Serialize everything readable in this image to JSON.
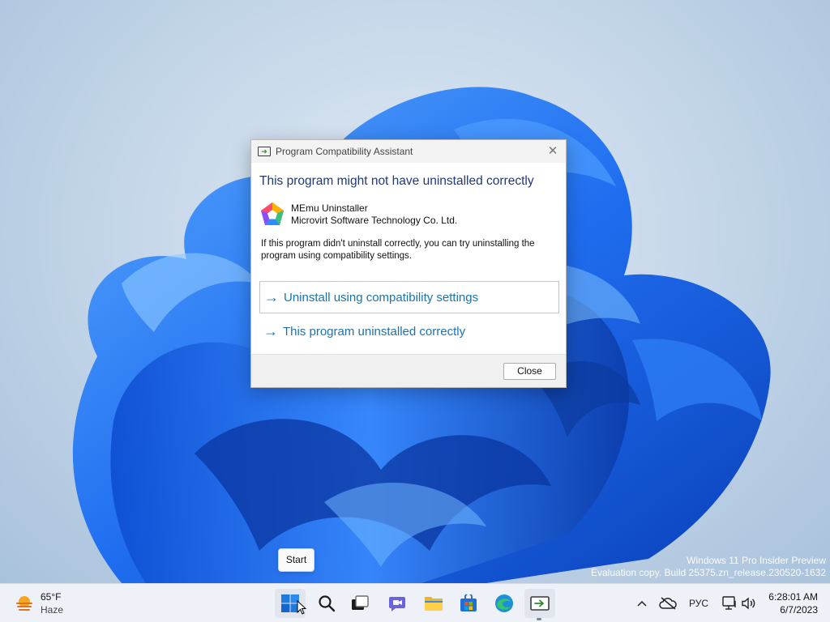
{
  "dialog": {
    "title": "Program Compatibility Assistant",
    "heading": "This program might not have uninstalled correctly",
    "app_name": "MEmu Uninstaller",
    "app_vendor": "Microvirt Software Technology Co. Ltd.",
    "description": "If this program didn't uninstall correctly, you can try uninstalling the program using compatibility settings.",
    "options": [
      {
        "arrow": "→",
        "label": "Uninstall using compatibility settings"
      },
      {
        "arrow": "→",
        "label": "This program uninstalled correctly"
      }
    ],
    "close_label": "Close",
    "close_glyph": "✕"
  },
  "tooltip": "Start",
  "watermark": {
    "line1": "Windows 11 Pro Insider Preview",
    "line2": "Evaluation copy. Build 25375.zn_release.230520-1632"
  },
  "taskbar": {
    "weather": {
      "temp": "65°F",
      "condition": "Haze"
    },
    "apps": [
      "start-icon",
      "search-icon",
      "task-view-icon",
      "chat-icon",
      "file-explorer-icon",
      "store-icon",
      "edge-icon",
      "compatibility-assistant-icon"
    ],
    "tray": {
      "chevron": "^",
      "language": "РУС",
      "time": "6:28:01 AM",
      "date": "6/7/2023"
    }
  },
  "colors": {
    "accent": "#1a73b0",
    "heading": "#1f3a78",
    "wallpaper_blue": "#1565e0"
  }
}
